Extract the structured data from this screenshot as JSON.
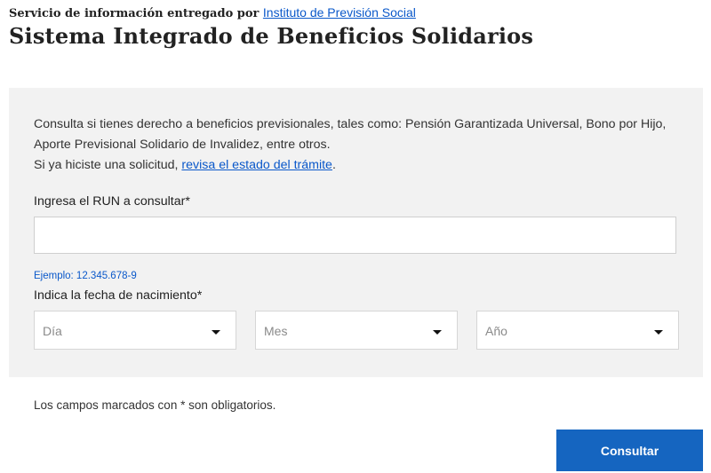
{
  "header": {
    "provider_prefix": "Servicio de información entregado por ",
    "provider_link": "Instituto de Previsión Social",
    "title": "Sistema Integrado de Beneficios Solidarios"
  },
  "form": {
    "intro_line1": "Consulta si tienes derecho a beneficios previsionales, tales como: Pensión Garantizada Universal, Bono por Hijo,",
    "intro_line2": "Aporte Previsional Solidario de Invalidez, entre otros.",
    "intro_line3_prefix": "Si ya hiciste una solicitud, ",
    "intro_link": "revisa el estado del trámite",
    "intro_line3_suffix": ".",
    "run_label": "Ingresa el RUN a consultar*",
    "run_value": "",
    "run_example": "Ejemplo: 12.345.678-9",
    "date_label": "Indica la fecha de nacimiento*",
    "day_placeholder": "Día",
    "month_placeholder": "Mes",
    "year_placeholder": "Año"
  },
  "footer": {
    "required_note": "Los campos marcados con * son obligatorios.",
    "submit_label": "Consultar"
  },
  "colors": {
    "accent": "#1565c0",
    "link": "#0a58ca",
    "panel_bg": "#f2f2f2"
  },
  "icons": {
    "select_caret": "caret-down-icon"
  }
}
